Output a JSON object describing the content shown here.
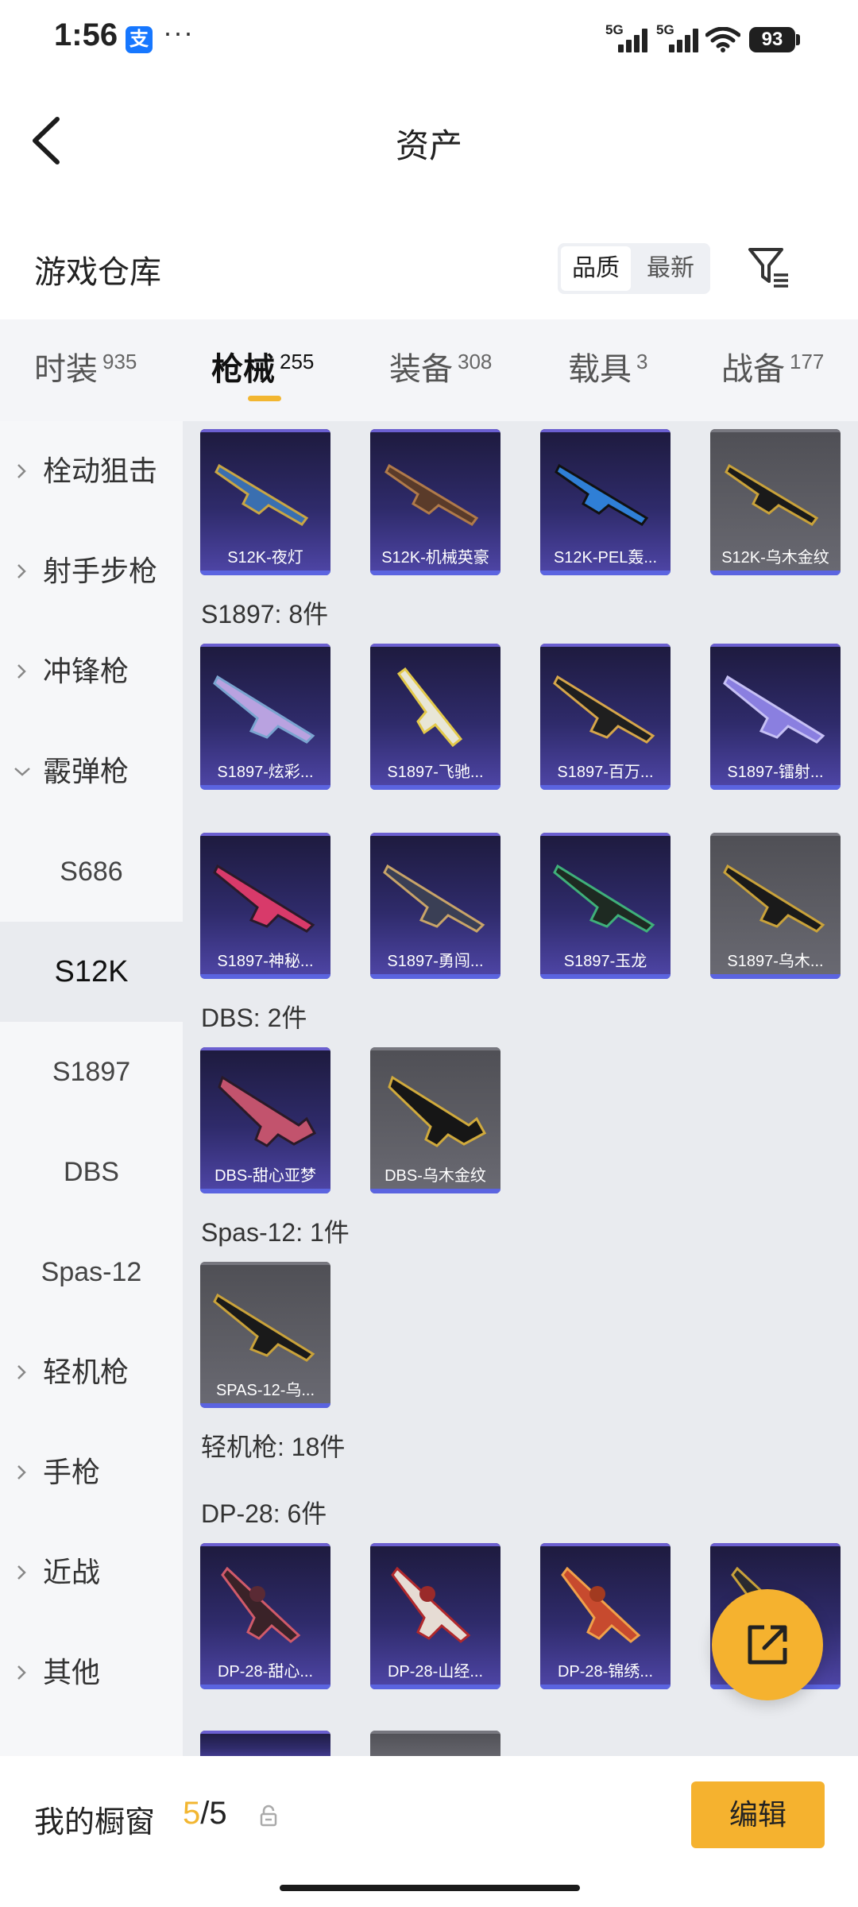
{
  "status": {
    "time": "1:56",
    "app_badge": "支",
    "more": "···",
    "signal1_label": "5G",
    "signal2_label": "5G",
    "battery": "93"
  },
  "nav": {
    "title": "资产"
  },
  "warehouse": {
    "title": "游戏仓库",
    "sort_options": [
      "品质",
      "最新"
    ],
    "active_sort": "品质"
  },
  "tabs": [
    {
      "label": "时装",
      "count": "935"
    },
    {
      "label": "枪械",
      "count": "255"
    },
    {
      "label": "装备",
      "count": "308"
    },
    {
      "label": "载具",
      "count": "3"
    },
    {
      "label": "战备",
      "count": "177"
    }
  ],
  "active_tab": "枪械",
  "sidebar": [
    {
      "label": "栓动狙击",
      "type": "category"
    },
    {
      "label": "射手步枪",
      "type": "category"
    },
    {
      "label": "冲锋枪",
      "type": "category"
    },
    {
      "label": "霰弹枪",
      "type": "category-expanded"
    },
    {
      "label": "S686",
      "type": "sub"
    },
    {
      "label": "S12K",
      "type": "sub-selected"
    },
    {
      "label": "S1897",
      "type": "sub"
    },
    {
      "label": "DBS",
      "type": "sub"
    },
    {
      "label": "Spas-12",
      "type": "sub"
    },
    {
      "label": "轻机枪",
      "type": "category"
    },
    {
      "label": "手枪",
      "type": "category"
    },
    {
      "label": "近战",
      "type": "category"
    },
    {
      "label": "其他",
      "type": "category"
    }
  ],
  "sections": {
    "s1897": "S1897: 8件",
    "dbs": "DBS: 2件",
    "spas": "Spas-12: 1件",
    "lmg": "轻机枪: 18件",
    "dp28": "DP-28: 6件"
  },
  "items": {
    "s12k": [
      "S12K-夜灯",
      "S12K-机械英豪",
      "S12K-PEL轰...",
      "S12K-乌木金纹"
    ],
    "s1897_row1": [
      "S1897-炫彩...",
      "S1897-飞驰...",
      "S1897-百万...",
      "S1897-镭射..."
    ],
    "s1897_row2": [
      "S1897-神秘...",
      "S1897-勇闯...",
      "S1897-玉龙",
      "S1897-乌木..."
    ],
    "dbs": [
      "DBS-甜心亚梦",
      "DBS-乌木金纹"
    ],
    "spas": [
      "SPAS-12-乌..."
    ],
    "dp28": [
      "DP-28-甜心...",
      "DP-28-山经...",
      "DP-28-锦绣...",
      ""
    ]
  },
  "showcase": {
    "label": "我的橱窗",
    "current": "5",
    "total": "/5",
    "edit_label": "编辑"
  },
  "colors": {
    "accent": "#f5b22f",
    "tab_underline": "#f2b631",
    "card_purple": "#2f2b6b",
    "card_grey": "#5f5f66"
  }
}
